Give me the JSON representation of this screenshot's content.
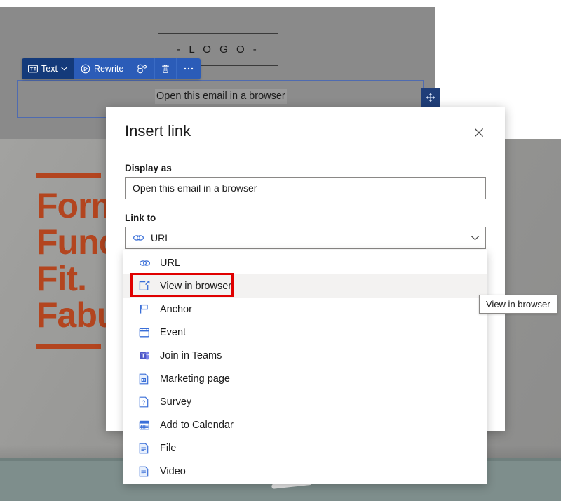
{
  "email_canvas": {
    "logo_placeholder": "- L O G O -",
    "selected_text": "Open this email in a browser",
    "hero_headline_lines": [
      "Form",
      "Func",
      "Fit.",
      "Fabu"
    ],
    "hero_accent_color": "#b3451f",
    "drag_handle_icon": "move-arrows-icon"
  },
  "toolbar": {
    "items": [
      {
        "label": "Text",
        "icon": "text-box-icon",
        "has_chevron": true,
        "active": true
      },
      {
        "label": "Rewrite",
        "icon": "rewrite-sparkle-icon",
        "has_chevron": false,
        "active": false
      },
      {
        "label": "",
        "icon": "link-styles-icon",
        "has_chevron": false,
        "active": false
      },
      {
        "label": "",
        "icon": "trash-icon",
        "has_chevron": false,
        "active": false
      },
      {
        "label": "",
        "icon": "more-ellipsis-icon",
        "has_chevron": false,
        "active": false
      }
    ]
  },
  "dialog": {
    "title": "Insert link",
    "close_icon": "close-icon",
    "display_as": {
      "label": "Display as",
      "value": "Open this email in a browser",
      "placeholder": "Display as"
    },
    "link_to": {
      "label": "Link to",
      "selected_value": "URL",
      "selected_icon": "link-chain-icon",
      "chevron_icon": "chevron-down-icon"
    }
  },
  "dropdown": {
    "highlighted_index": 1,
    "options": [
      {
        "label": "URL",
        "icon": "link-chain-icon",
        "color": "#3a6fd8"
      },
      {
        "label": "View in browser",
        "icon": "open-in-browser-icon",
        "color": "#3a6fd8"
      },
      {
        "label": "Anchor",
        "icon": "anchor-flag-icon",
        "color": "#3a6fd8"
      },
      {
        "label": "Event",
        "icon": "calendar-icon",
        "color": "#3a6fd8"
      },
      {
        "label": "Join in Teams",
        "icon": "teams-icon",
        "color": "#5059c9"
      },
      {
        "label": "Marketing page",
        "icon": "marketing-page-icon",
        "color": "#3a6fd8"
      },
      {
        "label": "Survey",
        "icon": "survey-icon",
        "color": "#3a6fd8"
      },
      {
        "label": "Add to Calendar",
        "icon": "add-to-calendar-icon",
        "color": "#3a6fd8"
      },
      {
        "label": "File",
        "icon": "file-icon",
        "color": "#3a6fd8"
      },
      {
        "label": "Video",
        "icon": "video-file-icon",
        "color": "#3a6fd8"
      }
    ]
  },
  "annotation": {
    "highlight_color": "#e00000",
    "tooltip_text": "View in browser"
  }
}
